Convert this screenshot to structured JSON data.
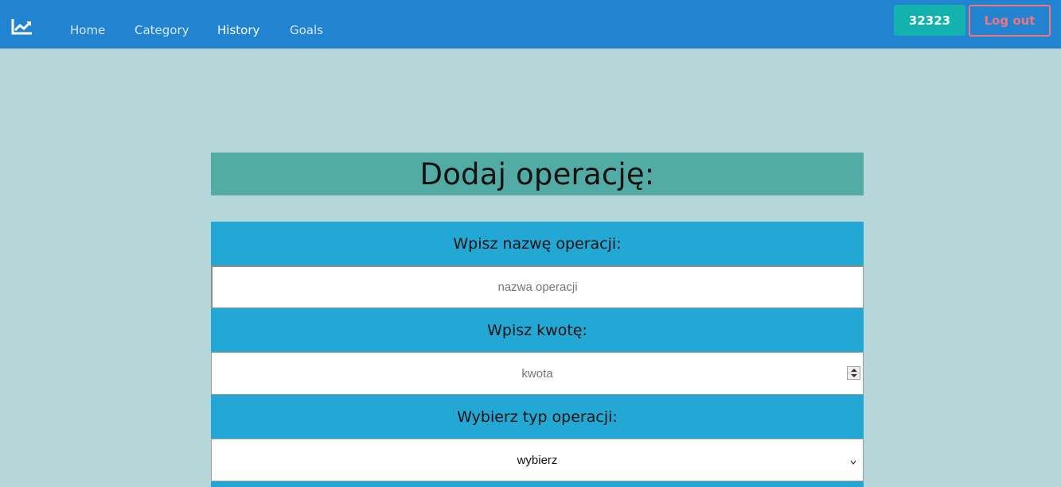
{
  "nav": {
    "logo_icon": "chart-line-icon",
    "items": [
      {
        "label": "Home",
        "active": false
      },
      {
        "label": "Category",
        "active": false
      },
      {
        "label": "History",
        "active": true
      },
      {
        "label": "Goals",
        "active": false
      }
    ],
    "user_label": "32323",
    "logout_label": "Log out"
  },
  "form": {
    "title": "Dodaj operację:",
    "name_label": "Wpisz nazwę operacji:",
    "name_placeholder": "nazwa operacji",
    "amount_label": "Wpisz kwotę:",
    "amount_placeholder": "kwota",
    "type_label": "Wybierz typ operacji:",
    "type_selected": "wybierz"
  },
  "colors": {
    "navbar": "#2284d1",
    "background": "#b6d7d9",
    "title_bar": "#52aca5",
    "label_band": "#23a8d6",
    "user_button": "#14b2ae",
    "logout_accent": "#f0757e"
  }
}
